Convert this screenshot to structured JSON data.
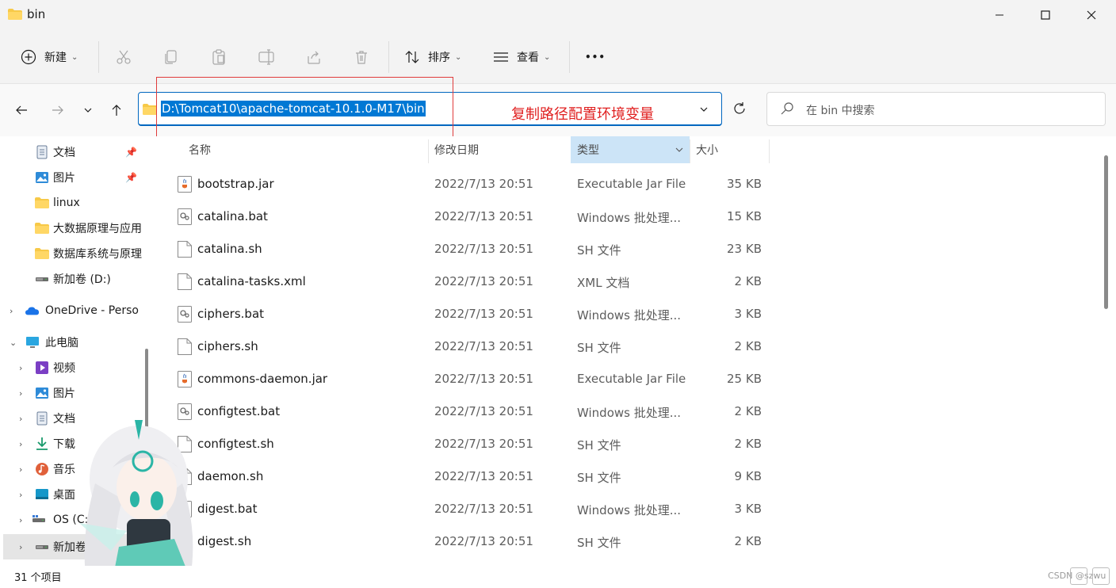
{
  "window": {
    "title": "bin"
  },
  "toolbar": {
    "new_label": "新建",
    "sort_label": "排序",
    "view_label": "查看",
    "more_label": "•••"
  },
  "address": {
    "path": "D:\\Tomcat10\\apache-tomcat-10.1.0-M17\\bin",
    "search_placeholder": "在 bin 中搜索"
  },
  "annotation": {
    "text": "复制路径配置环境变量",
    "color": "#e02020"
  },
  "sidebar": {
    "items": [
      {
        "label": "文档",
        "icon": "document-icon",
        "pinned": true
      },
      {
        "label": "图片",
        "icon": "pictures-icon",
        "pinned": true
      },
      {
        "label": "linux",
        "icon": "folder-icon"
      },
      {
        "label": "大数据原理与应用",
        "icon": "folder-icon"
      },
      {
        "label": "数据库系统与原理",
        "icon": "folder-icon"
      },
      {
        "label": "新加卷 (D:)",
        "icon": "drive-icon"
      },
      {
        "label": "OneDrive - Perso",
        "icon": "onedrive-icon"
      },
      {
        "label": "此电脑",
        "icon": "computer-icon"
      },
      {
        "label": "视频",
        "icon": "videos-icon"
      },
      {
        "label": "图片",
        "icon": "pictures-icon"
      },
      {
        "label": "文档",
        "icon": "document-icon"
      },
      {
        "label": "下载",
        "icon": "download-icon"
      },
      {
        "label": "音乐",
        "icon": "music-icon"
      },
      {
        "label": "桌面",
        "icon": "desktop-icon"
      },
      {
        "label": "OS (C:)",
        "icon": "drive-icon"
      },
      {
        "label": "新加卷 (D:)",
        "icon": "drive-icon"
      }
    ]
  },
  "columns": {
    "name": "名称",
    "date": "修改日期",
    "type": "类型",
    "size": "大小"
  },
  "files": [
    {
      "name": "bootstrap.jar",
      "date": "2022/7/13 20:51",
      "type": "Executable Jar File",
      "size": "35 KB",
      "icon": "jar-icon"
    },
    {
      "name": "catalina.bat",
      "date": "2022/7/13 20:51",
      "type": "Windows 批处理...",
      "size": "15 KB",
      "icon": "bat-icon"
    },
    {
      "name": "catalina.sh",
      "date": "2022/7/13 20:51",
      "type": "SH 文件",
      "size": "23 KB",
      "icon": "file-icon"
    },
    {
      "name": "catalina-tasks.xml",
      "date": "2022/7/13 20:51",
      "type": "XML 文档",
      "size": "2 KB",
      "icon": "file-icon"
    },
    {
      "name": "ciphers.bat",
      "date": "2022/7/13 20:51",
      "type": "Windows 批处理...",
      "size": "3 KB",
      "icon": "bat-icon"
    },
    {
      "name": "ciphers.sh",
      "date": "2022/7/13 20:51",
      "type": "SH 文件",
      "size": "2 KB",
      "icon": "file-icon"
    },
    {
      "name": "commons-daemon.jar",
      "date": "2022/7/13 20:51",
      "type": "Executable Jar File",
      "size": "25 KB",
      "icon": "jar-icon"
    },
    {
      "name": "configtest.bat",
      "date": "2022/7/13 20:51",
      "type": "Windows 批处理...",
      "size": "2 KB",
      "icon": "bat-icon"
    },
    {
      "name": "configtest.sh",
      "date": "2022/7/13 20:51",
      "type": "SH 文件",
      "size": "2 KB",
      "icon": "file-icon"
    },
    {
      "name": "daemon.sh",
      "date": "2022/7/13 20:51",
      "type": "SH 文件",
      "size": "9 KB",
      "icon": "file-icon"
    },
    {
      "name": "digest.bat",
      "date": "2022/7/13 20:51",
      "type": "Windows 批处理...",
      "size": "3 KB",
      "icon": "bat-icon"
    },
    {
      "name": "digest.sh",
      "date": "2022/7/13 20:51",
      "type": "SH 文件",
      "size": "2 KB",
      "icon": "file-icon"
    }
  ],
  "status": {
    "count": "31 个项目",
    "watermark": "CSDN @szwu"
  }
}
